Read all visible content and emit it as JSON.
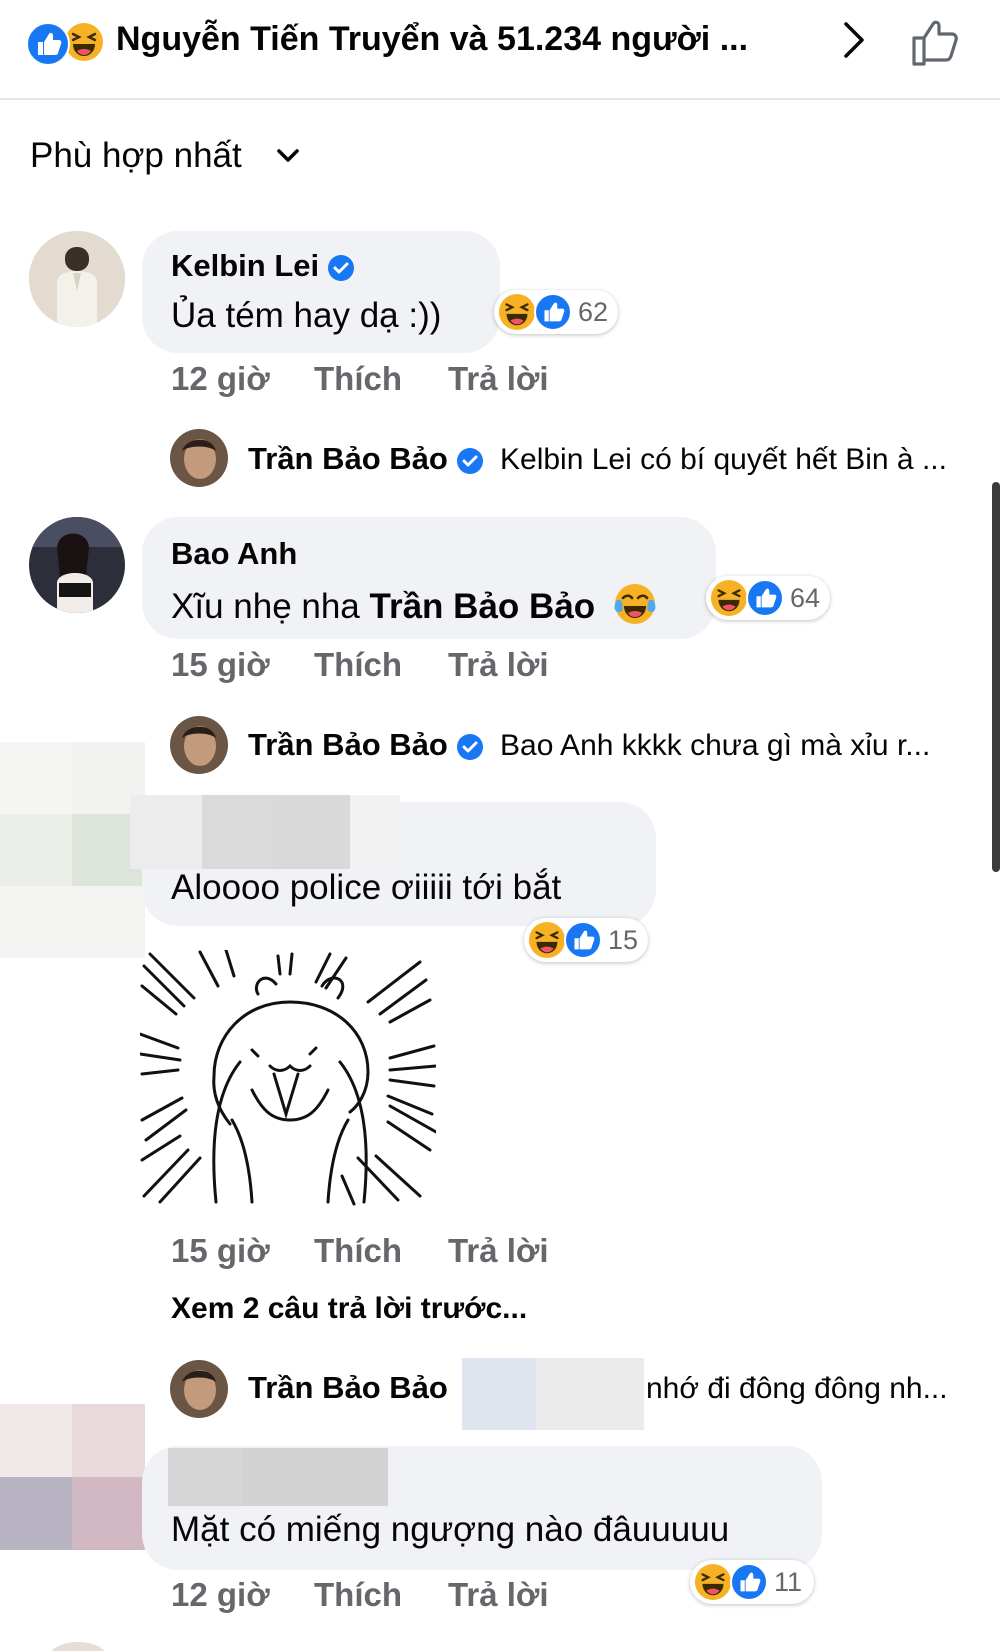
{
  "header": {
    "title": "Nguyễn Tiến Truyển và 51.234 người ...",
    "icons": [
      "like-reaction-icon",
      "haha-reaction-icon",
      "chevron-right-icon",
      "thumbs-up-outline-icon"
    ]
  },
  "sort": {
    "label": "Phù hợp nhất",
    "icon": "chevron-down-icon"
  },
  "comments": [
    {
      "author": "Kelbin Lei",
      "verified": true,
      "text": "Ủa tém hay dạ :))",
      "reaction_count": "62",
      "time": "12 giờ",
      "like_label": "Thích",
      "reply_label": "Trả lời",
      "reply": {
        "author": "Trần Bảo Bảo",
        "verified": true,
        "text": "Kelbin Lei có bí quyết hết Bin à ..."
      }
    },
    {
      "author": "Bao Anh",
      "verified": false,
      "text_prefix": "Xĩu nhẹ nha ",
      "mention": "Trần Bảo Bảo",
      "emoji": "tears-of-joy-emoji",
      "reaction_count": "64",
      "time": "15 giờ",
      "like_label": "Thích",
      "reply_label": "Trả lời",
      "reply": {
        "author": "Trần Bảo Bảo",
        "verified": true,
        "text": "Bao Anh kkkk chưa  gì mà xỉu r..."
      }
    },
    {
      "author": "",
      "text": "Aloooo police ơiiiii tới bắt",
      "reaction_count": "15",
      "sticker": "bunny-cheering-sticker",
      "time": "15 giờ",
      "like_label": "Thích",
      "reply_label": "Trả lời",
      "see_more": "Xem 2 câu trả lời trước...",
      "reply": {
        "author": "Trần Bảo Bảo",
        "verified": false,
        "text": "nhớ đi đông đông nh..."
      }
    },
    {
      "author": "",
      "text": "Mặt có miếng ngượng nào đâuuuuu",
      "reaction_count": "11",
      "time": "12 giờ",
      "like_label": "Thích",
      "reply_label": "Trả lời"
    }
  ],
  "colors": {
    "accent": "#1877f2",
    "bubble": "#f0f2f5",
    "meta": "#65676b",
    "haha": "#f7b125"
  }
}
